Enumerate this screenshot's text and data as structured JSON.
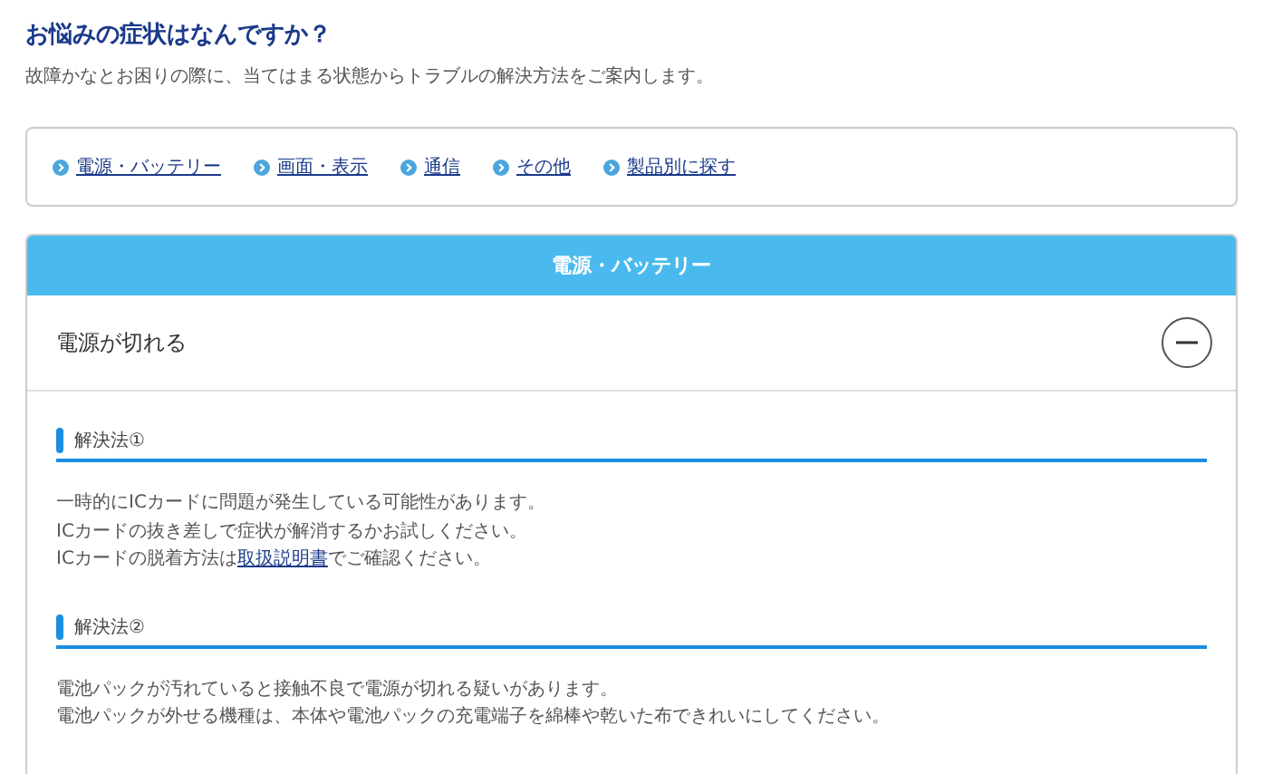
{
  "heading": "お悩みの症状はなんですか？",
  "intro": "故障かなとお困りの際に、当てはまる状態からトラブルの解決方法をご案内します。",
  "nav_links": [
    "電源・バッテリー",
    "画面・表示",
    "通信",
    "その他",
    "製品別に探す"
  ],
  "category": {
    "title": "電源・バッテリー",
    "question": {
      "label": "電源が切れる",
      "expanded": true
    },
    "solutions": [
      {
        "title": "解決法①",
        "lines": [
          [
            {
              "kind": "text",
              "text": "一時的にICカードに問題が発生している可能性があります。"
            }
          ],
          [
            {
              "kind": "text",
              "text": "ICカードの抜き差しで症状が解消するかお試しください。"
            }
          ],
          [
            {
              "kind": "text",
              "text": "ICカードの脱着方法は"
            },
            {
              "kind": "link",
              "text": "取扱説明書"
            },
            {
              "kind": "text",
              "text": "でご確認ください。"
            }
          ]
        ]
      },
      {
        "title": "解決法②",
        "lines": [
          [
            {
              "kind": "text",
              "text": "電池パックが汚れていると接触不良で電源が切れる疑いがあります。"
            }
          ],
          [
            {
              "kind": "text",
              "text": "電池パックが外せる機種は、本体や電池パックの充電端子を綿棒や乾いた布できれいにしてください。"
            }
          ]
        ]
      }
    ]
  }
}
